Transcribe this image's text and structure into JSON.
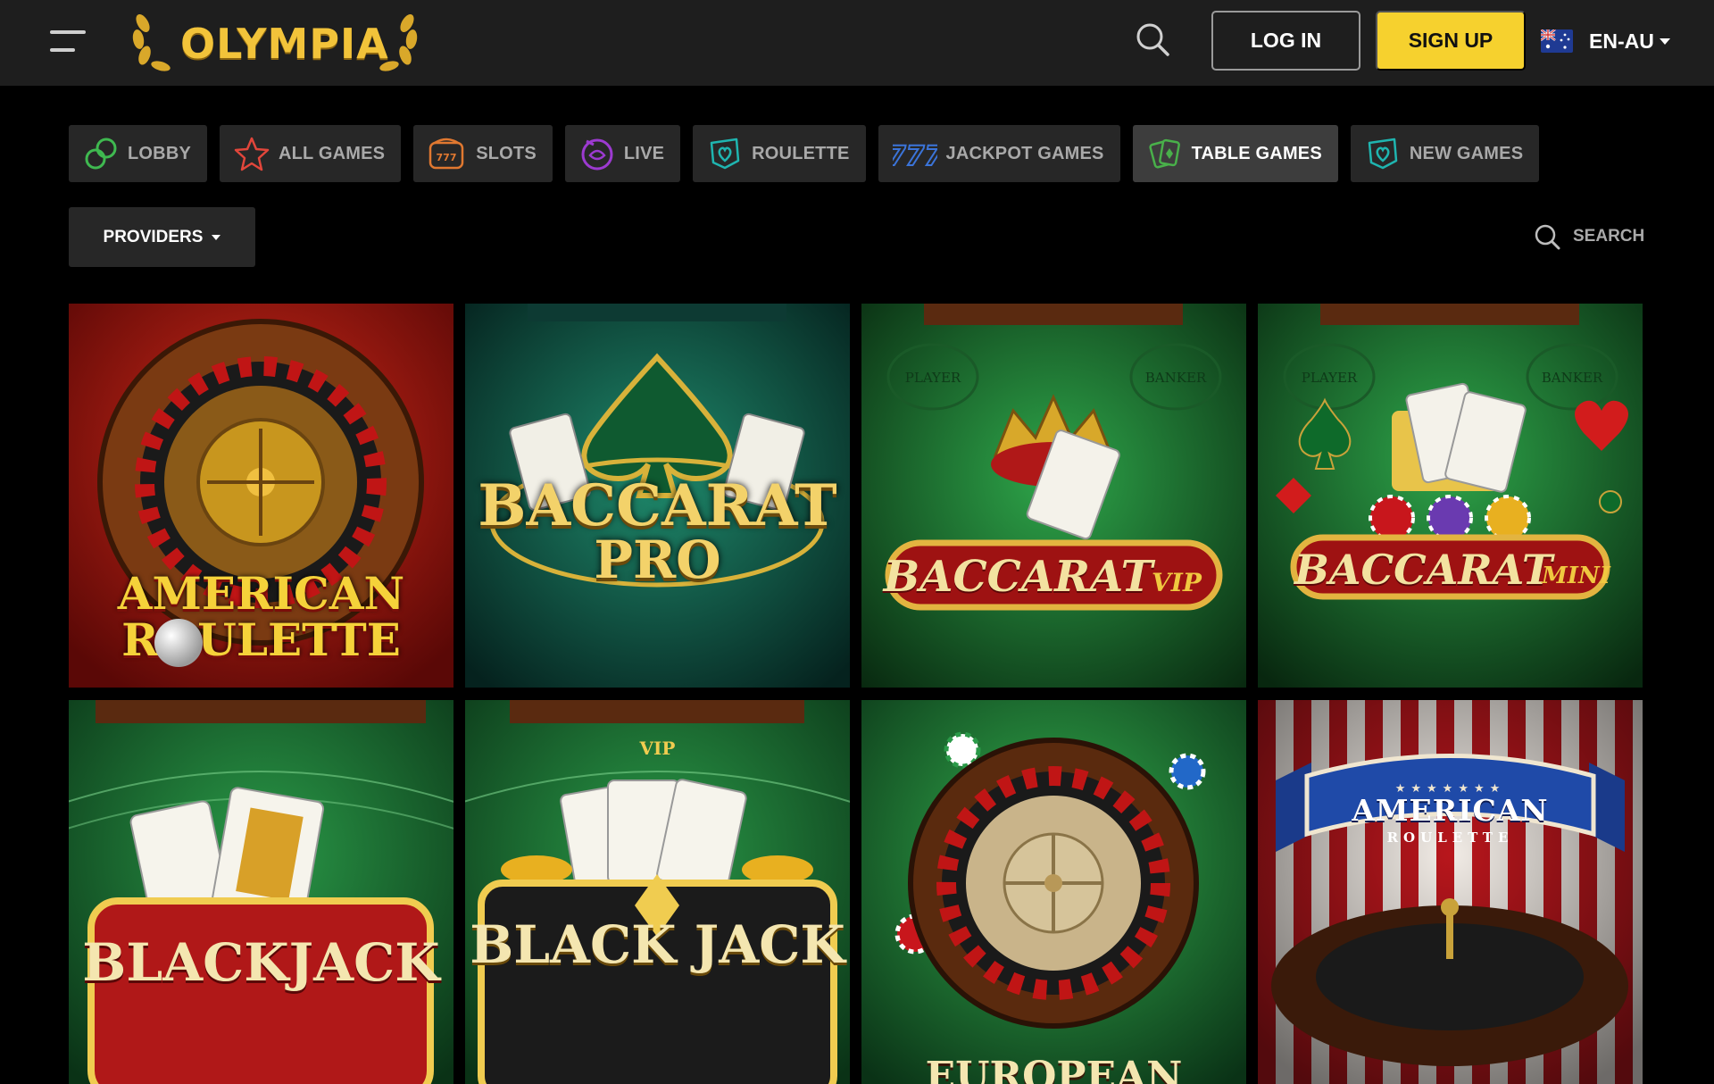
{
  "brand": {
    "name": "OLYMPIA"
  },
  "header": {
    "login_label": "LOG IN",
    "signup_label": "SIGN UP",
    "language": "EN-AU"
  },
  "tabs": [
    {
      "label": "LOBBY",
      "icon": "chips-icon",
      "active": false
    },
    {
      "label": "ALL GAMES",
      "icon": "star-icon",
      "active": false
    },
    {
      "label": "SLOTS",
      "icon": "slot-machine-icon",
      "active": false
    },
    {
      "label": "LIVE",
      "icon": "live-dealer-icon",
      "active": false
    },
    {
      "label": "ROULETTE",
      "icon": "roulette-icon",
      "active": false
    },
    {
      "label": "JACKPOT GAMES",
      "icon": "jackpot-777-icon",
      "active": false
    },
    {
      "label": "TABLE GAMES",
      "icon": "cards-icon",
      "active": true
    },
    {
      "label": "NEW GAMES",
      "icon": "new-games-icon",
      "active": false
    }
  ],
  "filters": {
    "providers_label": "PROVIDERS",
    "search_label": "SEARCH"
  },
  "games": [
    {
      "title_line1": "AMERICAN",
      "title_line2": "ROULETTE",
      "theme": "red"
    },
    {
      "title_line1": "BACCARAT",
      "title_line2": "PRO",
      "theme": "teal"
    },
    {
      "title_line1": "BACCARAT",
      "title_line2": "VIP",
      "theme": "green",
      "table_labels": [
        "PLAYER",
        "BANKER"
      ]
    },
    {
      "title_line1": "BACCARAT",
      "title_line2": "MINI",
      "theme": "green",
      "table_labels": [
        "PLAYER",
        "BANKER"
      ]
    },
    {
      "title_line1": "BLACKJACK",
      "title_line2": "",
      "theme": "green"
    },
    {
      "title_line1": "VIP",
      "title_line2": "BLACK JACK",
      "title_main": "BLACK JACK",
      "theme": "green"
    },
    {
      "title_line1": "EUROPEAN",
      "title_line2": "",
      "theme": "green"
    },
    {
      "title_line1": "AMERICAN",
      "title_line2": "ROULETTE",
      "theme": "striped"
    }
  ],
  "colors": {
    "accent": "#f6d12e",
    "header_bg": "#1e1e1e",
    "tab_bg": "#272727",
    "tab_active_bg": "#3d3d3d"
  }
}
